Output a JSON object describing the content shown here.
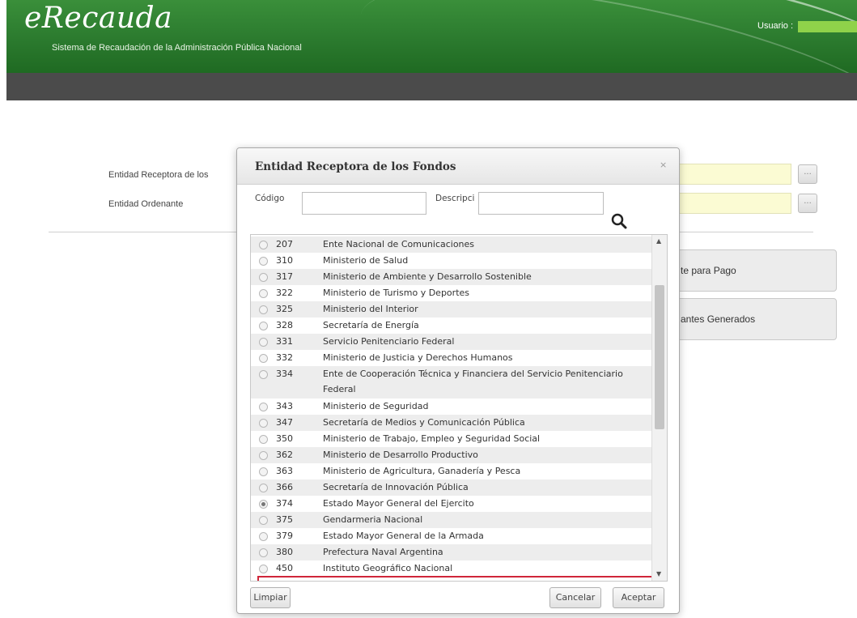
{
  "header": {
    "logo": "eRecauda",
    "subtitle": "Sistema de Recaudación de la Administración Pública Nacional",
    "user_label": "Usuario :"
  },
  "form": {
    "entidad_receptora_label": "Entidad Receptora de los",
    "entidad_ordenante_label": "Entidad Ordenante",
    "lookup_button": "...",
    "card1": "te para Pago",
    "card2": "antes Generados"
  },
  "dialog": {
    "title": "Entidad Receptora de los Fondos",
    "close": "×",
    "codigo_label": "Código",
    "codigo_value": "",
    "descripcion_label": "Descripci",
    "descripcion_value": "",
    "search_icon": "search-icon",
    "rows": [
      {
        "code": "207",
        "desc": "Ente Nacional de Comunicaciones"
      },
      {
        "code": "310",
        "desc": "Ministerio de Salud"
      },
      {
        "code": "317",
        "desc": "Ministerio de Ambiente y Desarrollo Sostenible"
      },
      {
        "code": "322",
        "desc": "Ministerio de Turismo y Deportes"
      },
      {
        "code": "325",
        "desc": "Ministerio del Interior"
      },
      {
        "code": "328",
        "desc": "Secretaría de Energía"
      },
      {
        "code": "331",
        "desc": "Servicio Penitenciario Federal"
      },
      {
        "code": "332",
        "desc": "Ministerio de Justicia y Derechos Humanos"
      },
      {
        "code": "334",
        "desc": "Ente de Cooperación Técnica y Financiera del Servicio Penitenciario Federal"
      },
      {
        "code": "343",
        "desc": "Ministerio de Seguridad"
      },
      {
        "code": "347",
        "desc": "Secretaría de Medios y Comunicación Pública"
      },
      {
        "code": "350",
        "desc": "Ministerio de Trabajo, Empleo y Seguridad Social"
      },
      {
        "code": "362",
        "desc": "Ministerio de Desarrollo Productivo"
      },
      {
        "code": "363",
        "desc": "Ministerio de Agricultura, Ganadería y Pesca"
      },
      {
        "code": "366",
        "desc": "Secretaría de Innovación Pública"
      },
      {
        "code": "374",
        "desc": "Estado Mayor General del Ejercito",
        "selected": true
      },
      {
        "code": "375",
        "desc": "Gendarmeria Nacional"
      },
      {
        "code": "379",
        "desc": "Estado Mayor General de la Armada"
      },
      {
        "code": "380",
        "desc": "Prefectura Naval Argentina"
      },
      {
        "code": "450",
        "desc": "Instituto Geográfico Nacional"
      }
    ],
    "buttons": {
      "limpiar": "Limpiar",
      "cancelar": "Cancelar",
      "aceptar": "Aceptar"
    }
  }
}
